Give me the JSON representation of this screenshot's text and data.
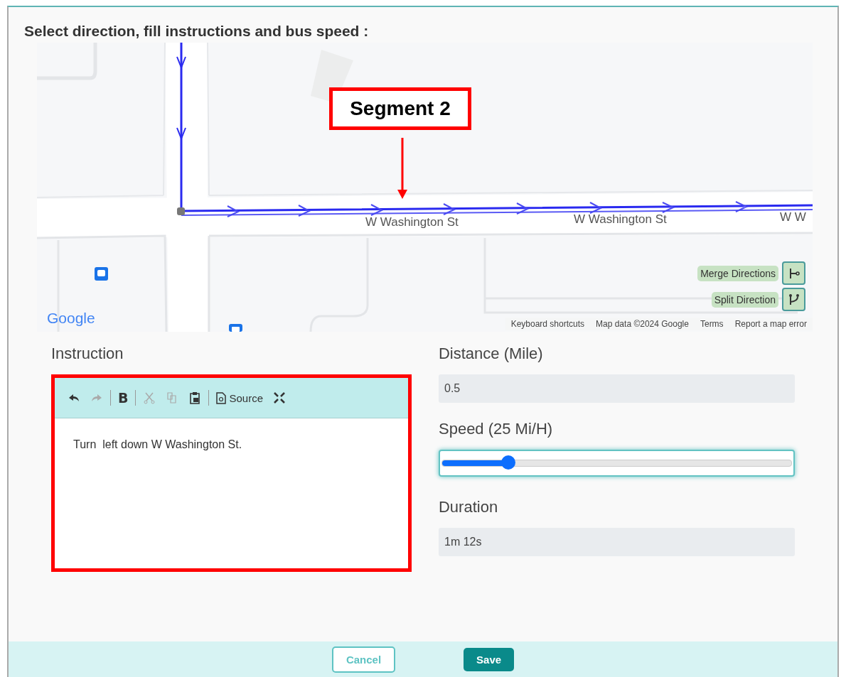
{
  "dialog": {
    "title": "Select direction, fill instructions and bus speed :"
  },
  "map": {
    "callout": "Segment 2",
    "street_labels": [
      "W Washington St",
      "W Washington St",
      "W W"
    ],
    "logo": "Google",
    "controls": [
      {
        "label": "Merge Directions",
        "kind": "merge"
      },
      {
        "label": "Split Direction",
        "kind": "split"
      }
    ],
    "attribution": [
      "Keyboard shortcuts",
      "Map data ©2024 Google",
      "Terms",
      "Report a map error"
    ]
  },
  "instruction": {
    "label": "Instruction",
    "highlighted": true,
    "toolbar": [
      {
        "kind": "undo",
        "disabled": false
      },
      {
        "kind": "redo",
        "disabled": true
      },
      {
        "kind": "sep"
      },
      {
        "kind": "bold",
        "label": "B",
        "disabled": false
      },
      {
        "kind": "sep"
      },
      {
        "kind": "cut",
        "disabled": true
      },
      {
        "kind": "copy",
        "disabled": true
      },
      {
        "kind": "paste",
        "disabled": false
      },
      {
        "kind": "sep"
      },
      {
        "kind": "source",
        "label": "Source",
        "disabled": false
      },
      {
        "kind": "maximize",
        "disabled": false
      }
    ],
    "text": "Turn  left down W Washington St."
  },
  "distance": {
    "label": "Distance (Mile)",
    "value": "0.5"
  },
  "speed": {
    "label": "Speed (25 Mi/H)",
    "level": 0.19
  },
  "duration": {
    "label": "Duration",
    "value": "1m 12s"
  },
  "buttons": [
    {
      "label": "Cancel",
      "kind": "secondary"
    },
    {
      "label": "Save",
      "kind": "primary"
    }
  ]
}
